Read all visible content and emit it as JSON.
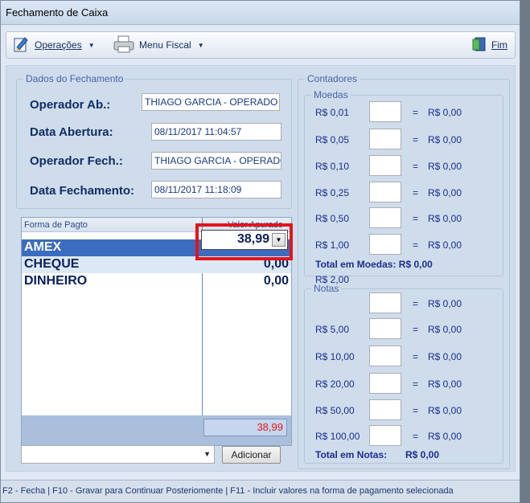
{
  "window": {
    "title": "Fechamento de Caixa"
  },
  "toolbar": {
    "operacoes": "Operações",
    "menu_fiscal": "Menu Fiscal",
    "fim": "Fim"
  },
  "dados": {
    "group_title": "Dados do Fechamento",
    "operador_ab_label": "Operador Ab.:",
    "operador_ab_value": "THIAGO GARCIA - OPERADO",
    "data_abertura_label": "Data Abertura:",
    "data_abertura_value": "08/11/2017 11:04:57",
    "operador_fech_label": "Operador Fech.:",
    "operador_fech_value": "THIAGO GARCIA - OPERADO",
    "data_fechamento_label": "Data Fechamento:",
    "data_fechamento_value": "08/11/2017 11:18:09"
  },
  "grid": {
    "col_forma": "Forma de Pagto",
    "col_valor": "Valor Apurado",
    "rows": [
      {
        "name": "AMEX",
        "value": "38,99"
      },
      {
        "name": "CHEQUE",
        "value": "0,00"
      },
      {
        "name": "DINHEIRO",
        "value": "0,00"
      }
    ],
    "total": "38,99"
  },
  "bottom": {
    "adicionar": "Adicionar"
  },
  "contadores": {
    "group_title": "Contadores",
    "moedas_title": "Moedas",
    "moedas": [
      {
        "label": "R$ 0,01",
        "eq": "=",
        "value": "R$ 0,00"
      },
      {
        "label": "R$ 0,05",
        "eq": "=",
        "value": "R$ 0,00"
      },
      {
        "label": "R$ 0,10",
        "eq": "=",
        "value": "R$ 0,00"
      },
      {
        "label": "R$ 0,25",
        "eq": "=",
        "value": "R$ 0,00"
      },
      {
        "label": "R$ 0,50",
        "eq": "=",
        "value": "R$ 0,00"
      },
      {
        "label": "R$ 1,00",
        "eq": "=",
        "value": "R$ 0,00"
      }
    ],
    "total_moedas": "Total em Moedas: R$ 0,00",
    "notas_title": "Notas",
    "notas": [
      {
        "label": "R$ 2,00",
        "eq": "=",
        "value": "R$ 0,00"
      },
      {
        "label": "R$ 5,00",
        "eq": "=",
        "value": "R$ 0,00"
      },
      {
        "label": "R$ 10,00",
        "eq": "=",
        "value": "R$ 0,00"
      },
      {
        "label": "R$ 20,00",
        "eq": "=",
        "value": "R$ 0,00"
      },
      {
        "label": "R$ 50,00",
        "eq": "=",
        "value": "R$ 0,00"
      },
      {
        "label": "R$ 100,00",
        "eq": "=",
        "value": "R$ 0,00"
      }
    ],
    "total_notas_label": "Total em Notas:",
    "total_notas_value": "R$ 0,00"
  },
  "status": "F2 - Fecha | F10 - Gravar para Continuar Posteriomente | F11 - Incluir valores na forma de pagamento selecionada",
  "colors": {
    "accent": "#1b2d8f",
    "highlight_border": "#e3141b",
    "total_red": "#e01818",
    "selected_row": "#3b6cc0"
  }
}
